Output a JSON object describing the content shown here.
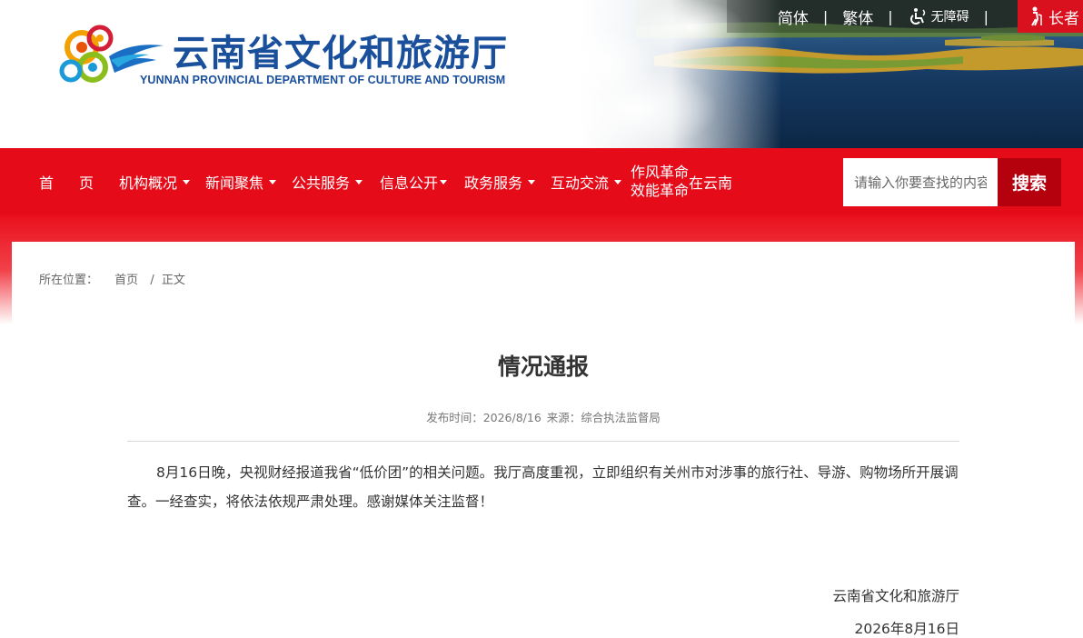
{
  "header": {
    "title": "云南省文化和旅游厅",
    "subtitle": "YUNNAN PROVINCIAL DEPARTMENT OF CULTURE AND TOURISM",
    "links": {
      "simplified": "简体",
      "traditional": "繁体",
      "accessibility": "无障碍",
      "elder": "长者"
    },
    "separator": "|"
  },
  "nav": {
    "items": [
      {
        "label": "首　页",
        "has_dropdown": false
      },
      {
        "label": "机构概况",
        "has_dropdown": true
      },
      {
        "label": "新闻聚焦",
        "has_dropdown": true
      },
      {
        "label": "公共服务",
        "has_dropdown": true
      },
      {
        "label": "信息公开",
        "has_dropdown": true
      },
      {
        "label": "政务服务",
        "has_dropdown": true
      },
      {
        "label": "互动交流",
        "has_dropdown": true
      }
    ],
    "special": {
      "line1": "作风革命",
      "line2": "效能革命",
      "suffix": "在云南"
    },
    "search_placeholder": "请输入你要查找的内容",
    "search_button": "搜索"
  },
  "breadcrumb": {
    "label": "所在位置：",
    "home": "首页",
    "separator": "/",
    "current": "正文"
  },
  "article": {
    "title": "情况通报",
    "publish_time": "发布时间：2026/8/16",
    "source": "来源：综合执法监督局",
    "body": "8月16日晚，央视财经报道我省“低价团”的相关问题。我厅高度重视，立即组织有关州市对涉事的旅行社、导游、购物场所开展调查。一经查实，将依法依规严肃处理。感谢媒体关注监督！",
    "signature_org": "云南省文化和旅游厅",
    "signature_date": "2026年8月16日"
  },
  "colors": {
    "nav_red": "#e50b19",
    "search_button": "#b5000e",
    "title_blue": "#1a4f9c"
  }
}
